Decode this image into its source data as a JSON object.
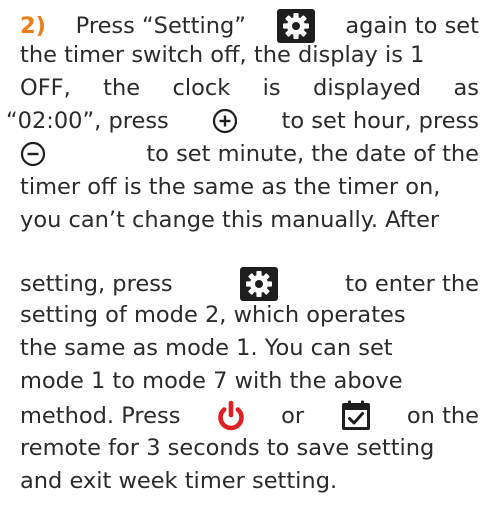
{
  "step": {
    "number": "2)"
  },
  "lines": {
    "l1a": "Press “Setting”",
    "l1b": "again to set",
    "l2": "the timer switch off, the display is 1",
    "l3": "OFF, the clock is displayed as",
    "l4a": "“02:00”, press",
    "l4b": "to set hour, press",
    "l5": "to set minute, the date of the",
    "l6": "timer off is the same as the timer on,",
    "l7": "you can’t change this manually. After",
    "l8a": "setting, press",
    "l8b": "to enter the",
    "l9": "setting of mode 2, which operates",
    "l10": "the same as mode 1. You can set",
    "l11": "mode 1 to mode 7 with the above",
    "l12a": "method. Press",
    "l12b": "or",
    "l12c": "on the",
    "l13": "remote for 3 seconds to save setting",
    "l14": "and exit week timer setting."
  },
  "icons": {
    "gear": "gear-icon",
    "plus": "plus-circle-icon",
    "minus": "minus-circle-icon",
    "power": "power-icon",
    "calendar": "calendar-icon"
  },
  "colors": {
    "text": "#2b2b2b",
    "step": "#ee7d1a",
    "power": "#e02020",
    "icon_dark": "#1e1e1e"
  }
}
